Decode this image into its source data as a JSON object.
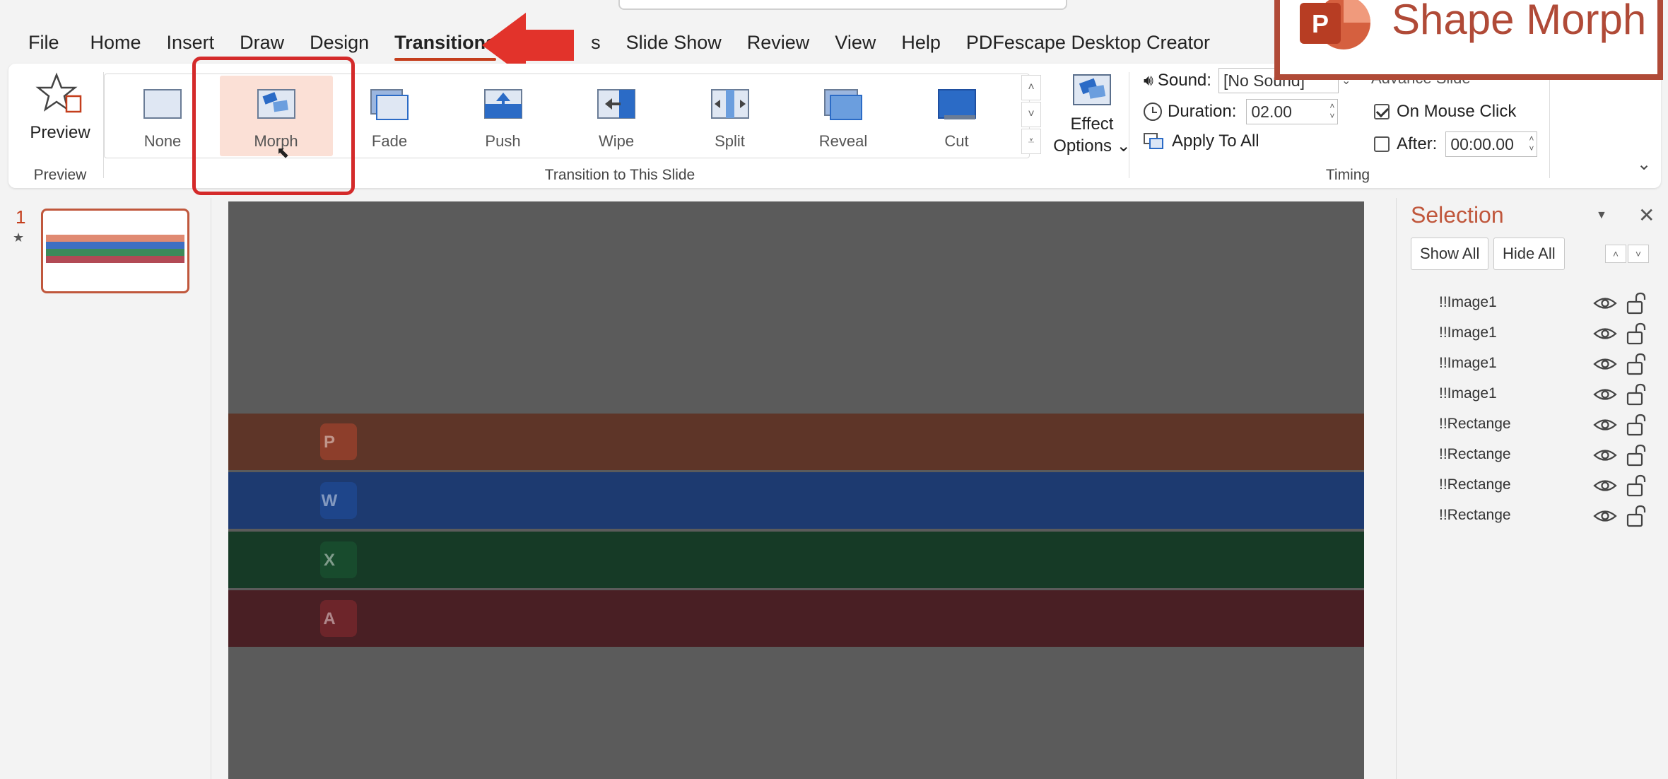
{
  "menu": {
    "items": [
      "File",
      "Home",
      "Insert",
      "Draw",
      "Design",
      "Transitions",
      "s",
      "Slide Show",
      "Review",
      "View",
      "Help",
      "PDFescape Desktop Creator"
    ],
    "active_index": 5
  },
  "ribbon": {
    "preview": {
      "label": "Preview",
      "group_label": "Preview"
    },
    "transitions": {
      "group_label": "Transition to This Slide",
      "items": [
        {
          "label": "None",
          "icon": "none-transition-icon"
        },
        {
          "label": "Morph",
          "icon": "morph-transition-icon"
        },
        {
          "label": "Fade",
          "icon": "fade-transition-icon"
        },
        {
          "label": "Push",
          "icon": "push-transition-icon"
        },
        {
          "label": "Wipe",
          "icon": "wipe-transition-icon"
        },
        {
          "label": "Split",
          "icon": "split-transition-icon"
        },
        {
          "label": "Reveal",
          "icon": "reveal-transition-icon"
        },
        {
          "label": "Cut",
          "icon": "cut-transition-icon"
        }
      ],
      "selected_index": 1
    },
    "effect_options": {
      "line1": "Effect",
      "line2": "Options ⌄"
    },
    "timing": {
      "group_label": "Timing",
      "sound_label": "Sound:",
      "sound_value": "[No Sound]",
      "duration_label": "Duration:",
      "duration_value": "02.00",
      "apply_all_label": "Apply To All",
      "advance_label": "Advance Slide",
      "on_mouse_click_label": "On Mouse Click",
      "on_mouse_click_checked": true,
      "after_label": "After:",
      "after_value": "00:00.00",
      "after_checked": false
    }
  },
  "overlay": {
    "brand_text": "Shape Morph",
    "brand_letter": "P"
  },
  "thumbnails": {
    "slide_number": "1",
    "star": "★"
  },
  "slide": {
    "bands": [
      {
        "letter": "P",
        "color": "#5e3528",
        "logo_color": "#b4452e"
      },
      {
        "letter": "W",
        "color": "#1d3a70",
        "logo_color": "#1f4fa0"
      },
      {
        "letter": "X",
        "color": "#163a26",
        "logo_color": "#1c5a33"
      },
      {
        "letter": "A",
        "color": "#491f24",
        "logo_color": "#8a2a2f"
      }
    ]
  },
  "selection_pane": {
    "title": "Selection",
    "show_all": "Show All",
    "hide_all": "Hide All",
    "items": [
      "!!Image1",
      "!!Image1",
      "!!Image1",
      "!!Image1",
      "!!Rectange",
      "!!Rectange",
      "!!Rectange",
      "!!Rectange"
    ]
  },
  "colors": {
    "accent": "#c43e1c",
    "highlight_rect": "#d42a2a",
    "brand": "#b04a37",
    "canvas": "#5b5b5b"
  }
}
